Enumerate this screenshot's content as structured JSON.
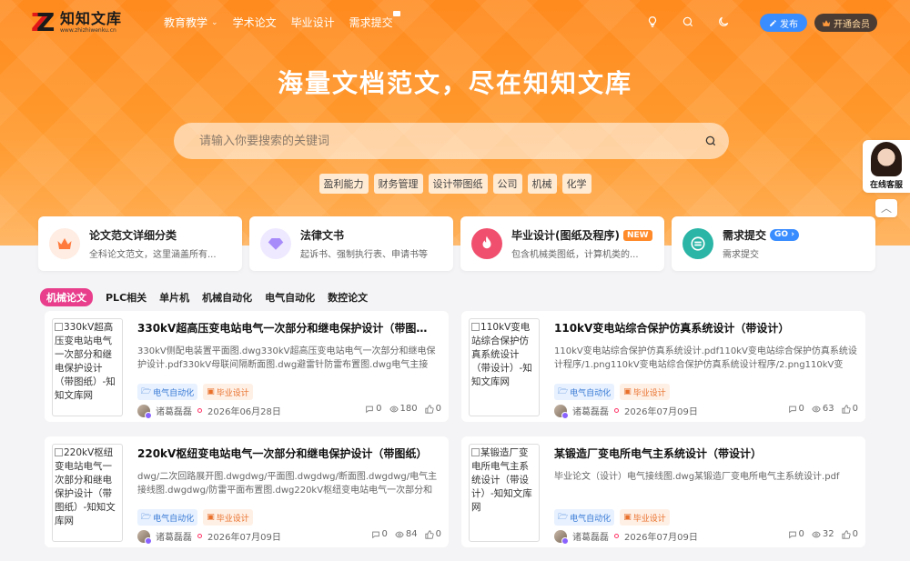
{
  "header": {
    "logo_title": "知知文库",
    "logo_sub": "www.zhizhiwenku.cn",
    "nav": [
      {
        "label": "教育教学",
        "has_dropdown": true
      },
      {
        "label": "学术论文"
      },
      {
        "label": "毕业设计"
      },
      {
        "label": "需求提交",
        "hot": true
      }
    ],
    "publish_label": "发布",
    "vip_label": "开通会员",
    "icons": [
      "lightbulb-icon",
      "search-icon",
      "moon-icon"
    ]
  },
  "hero": {
    "title": "海量文档范文，尽在知知文库",
    "search_placeholder": "请输入你要搜索的关键词",
    "tags": [
      "盈利能力",
      "财务管理",
      "设计带图纸",
      "公司",
      "机械",
      "化学"
    ]
  },
  "categories": [
    {
      "title": "论文范文详细分类",
      "desc": "全科论文范文，这里涵盖所有...",
      "icon": "crown-icon",
      "color": "#ff7a3c"
    },
    {
      "title": "法律文书",
      "desc": "起诉书、强制执行表、申请书等",
      "icon": "diamond-icon",
      "color": "#a78bfa"
    },
    {
      "title": "毕业设计(图纸及程序)",
      "desc": "包含机械类图纸，计算机类的...",
      "badge": "NEW",
      "icon": "fire-icon",
      "color": "#f0506e"
    },
    {
      "title": "需求提交",
      "desc": "需求提交",
      "badge": "GO",
      "icon": "submit-icon",
      "color": "#2bb5a6"
    }
  ],
  "tabs": [
    "机械论文",
    "PLC相关",
    "单片机",
    "机械自动化",
    "电气自动化",
    "数控论文"
  ],
  "docs": [
    {
      "thumb_alt": "330kV超高压变电站电气一次部分和继电保护设计（带图纸）-知知文库网",
      "title": "330kV超高压变电站电气一次部分和继电保护设计（带图纸）",
      "desc": "330kV侧配电装置平面图.dwg330kV超高压变电站电气一次部分和继电保护设计.pdf330kV母联间隔断面图.dwg避雷针防雷布置图.dwg电气主接线...",
      "chip1": "电气自动化",
      "chip2": "毕业设计",
      "author": "诸葛磊磊",
      "date": "2026年06月28日",
      "comments": "0",
      "views": "180",
      "likes": "0"
    },
    {
      "thumb_alt": "110kV变电站综合保护仿真系统设计（带设计）-知知文库网",
      "title": "110kV变电站综合保护仿真系统设计（带设计）",
      "desc": "110kV变电站综合保护仿真系统设计.pdf110kV变电站综合保护仿真系统设计程序/1.png110kV变电站综合保护仿真系统设计程序/2.png110kV变电...",
      "chip1": "电气自动化",
      "chip2": "毕业设计",
      "author": "诸葛磊磊",
      "date": "2026年07月09日",
      "comments": "0",
      "views": "63",
      "likes": "0"
    },
    {
      "thumb_alt": "220kV枢纽变电站电气一次部分和继电保护设计（带图纸）-知知文库网",
      "title": "220kV枢纽变电站电气一次部分和继电保护设计（带图纸）",
      "desc": "dwg/二次回路展开图.dwgdwg/平面图.dwgdwg/断面图.dwgdwg/电气主接线图.dwgdwg/防雷平面布置图.dwg220kV枢纽变电站电气一次部分和继...",
      "chip1": "电气自动化",
      "chip2": "毕业设计",
      "author": "诸葛磊磊",
      "date": "2026年07月09日",
      "comments": "0",
      "views": "84",
      "likes": "0"
    },
    {
      "thumb_alt": "某锻造厂变电所电气主系统设计（带设计）-知知文库网",
      "title": "某锻造厂变电所电气主系统设计（带设计）",
      "desc": "毕业论文（设计）电气接线图.dwg某锻造厂变电所电气主系统设计.pdf",
      "chip1": "电气自动化",
      "chip2": "毕业设计",
      "author": "诸葛磊磊",
      "date": "2026年07月09日",
      "comments": "0",
      "views": "32",
      "likes": "0"
    }
  ],
  "service": {
    "label": "在线客服"
  }
}
